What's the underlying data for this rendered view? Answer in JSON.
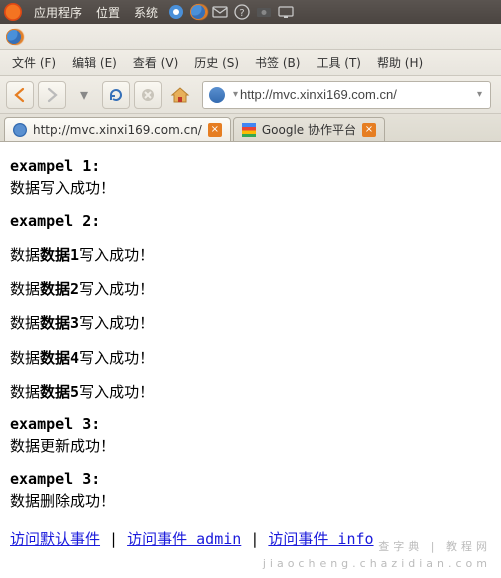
{
  "topbar": {
    "apps": "应用程序",
    "places": "位置",
    "system": "系统"
  },
  "menubar": {
    "file": "文件 (F)",
    "edit": "编辑 (E)",
    "view": "查看 (V)",
    "history": "历史 (S)",
    "bookmarks": "书签 (B)",
    "tools": "工具 (T)",
    "help": "帮助 (H)"
  },
  "url": "http://mvc.xinxi169.com.cn/",
  "tabs": [
    {
      "label": "http://mvc.xinxi169.com.cn/"
    },
    {
      "label": "Google 协作平台"
    }
  ],
  "page": {
    "ex1_title": "exampel 1:",
    "ex1_line": "数据写入成功！",
    "ex2_title": "exampel 2:",
    "dprefix": "数据",
    "dbold": "数据",
    "dsuffix": "写入成功！",
    "nums": [
      "1",
      "2",
      "3",
      "4",
      "5"
    ],
    "ex3a_title": "exampel 3:",
    "ex3a_line": "数据更新成功！",
    "ex3b_title": "exampel 3:",
    "ex3b_line": "数据删除成功！",
    "link1": "访问默认事件",
    "link2": "访问事件 admin",
    "link3": "访问事件 info",
    "sep": " | "
  },
  "watermark1": "查字典 | 教程网",
  "watermark2": "jiaocheng.chazidian.com"
}
